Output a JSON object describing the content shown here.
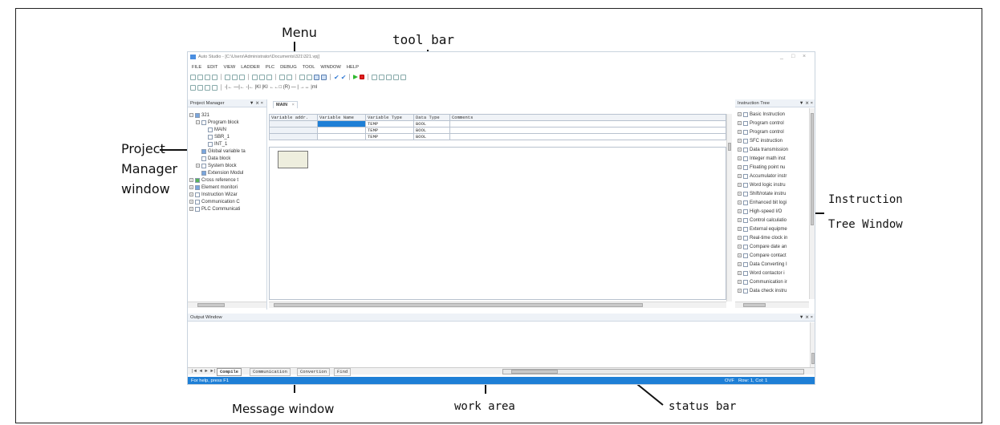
{
  "annotations": {
    "menu": "Menu",
    "toolbar": "tool bar",
    "project_manager_line1": "Project",
    "project_manager_line2": "Manager",
    "project_manager_line3": "window",
    "instruction_tree_line1": "Instruction",
    "instruction_tree_line2": "Tree Window",
    "message_window": "Message window",
    "work_area": "work area",
    "status_bar": "status bar"
  },
  "app": {
    "title": "Auto Studio - [C:\\Users\\Administrator\\Documents\\321\\321.vpj]",
    "menu": [
      "FILE",
      "EDIT",
      "VIEW",
      "LADDER",
      "PLC",
      "DEBUG",
      "TOOL",
      "WINDOW",
      "HELP"
    ],
    "window_controls": [
      "_",
      "□",
      "×"
    ],
    "toolbar2_text": "-|← —|← -|← |KI  |KI  ←←□ (R)  — |  →↔ |ml"
  },
  "project_manager": {
    "title": "Project Manager",
    "controls": "▼ ⨯ ×",
    "items": [
      {
        "label": "321",
        "level": 0,
        "expander": "−",
        "icon": "blue"
      },
      {
        "label": "Program block",
        "level": 1,
        "expander": "−",
        "icon": "white"
      },
      {
        "label": "MAIN",
        "level": 2,
        "expander": "",
        "icon": "white"
      },
      {
        "label": "SBR_1",
        "level": 2,
        "expander": "",
        "icon": "white"
      },
      {
        "label": "INT_1",
        "level": 2,
        "expander": "",
        "icon": "white"
      },
      {
        "label": "Global variable ta",
        "level": 1,
        "expander": "",
        "icon": "blue"
      },
      {
        "label": "Data block",
        "level": 1,
        "expander": "",
        "icon": "white"
      },
      {
        "label": "System block",
        "level": 1,
        "expander": "+",
        "icon": "white"
      },
      {
        "label": "Extension Modul",
        "level": 1,
        "expander": "",
        "icon": "blue"
      },
      {
        "label": "Cross reference t",
        "level": 1,
        "expander": "+",
        "icon": "green"
      },
      {
        "label": "Element monitori",
        "level": 1,
        "expander": "+",
        "icon": "blue"
      },
      {
        "label": "Instruction Wizar",
        "level": 1,
        "expander": "+",
        "icon": "white"
      },
      {
        "label": "Communication C",
        "level": 1,
        "expander": "+",
        "icon": "white"
      },
      {
        "label": "PLC Communicati",
        "level": 1,
        "expander": "+",
        "icon": "white"
      }
    ]
  },
  "editor": {
    "tab_label": "MAIN",
    "tab_close": "×",
    "table": {
      "headers": [
        "Variable addr.",
        "Variable Name",
        "Variable Type",
        "Data Type",
        "Comments"
      ],
      "rows": [
        [
          "",
          "",
          "TEMP",
          "BOOL",
          ""
        ],
        [
          "",
          "",
          "TEMP",
          "BOOL",
          ""
        ],
        [
          "",
          "",
          "TEMP",
          "BOOL",
          ""
        ]
      ]
    }
  },
  "instruction_tree": {
    "title": "Instruction Tree",
    "controls": "▼ ⨯ ×",
    "items": [
      "Basic Instruction",
      "Program control",
      "Program control",
      "SFC instruction",
      "Data transmission",
      "Integer math inst",
      "Floating point nu",
      "Accumulator instr",
      "Word logic instru",
      "Shift/rotate instru",
      "Enhanced bit logi",
      "High-speed I/O",
      "Control calculatio",
      "External equipme",
      "Real-time clock in",
      "Compare date an",
      "Compare contact",
      "Data Converting I",
      "Word contactor i",
      "Communication ir",
      "Data check instru"
    ]
  },
  "output_window": {
    "title": "Output Window",
    "controls": "▼ ⨯ ×",
    "tabs": [
      "Compile",
      "Communication",
      "Convertion",
      "Find"
    ],
    "nav": "|◄ ◄ ► ►|"
  },
  "status_bar": {
    "help_text": "For help, press F1",
    "mode": "OVF",
    "position": "Row: 1, Col: 1"
  }
}
